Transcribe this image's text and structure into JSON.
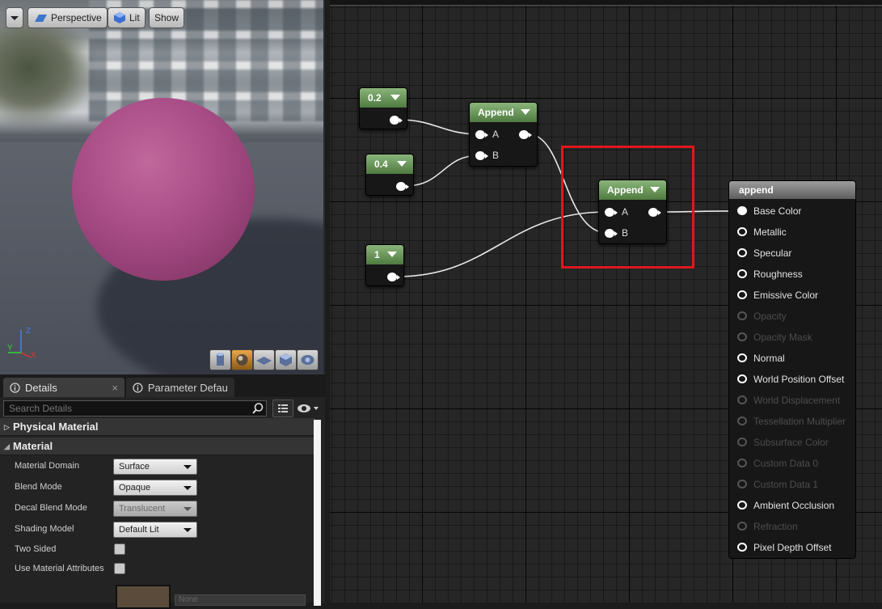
{
  "viewport": {
    "menu_label": "",
    "perspective_label": "Perspective",
    "lit_label": "Lit",
    "show_label": "Show",
    "axes": {
      "x": "X",
      "y": "Y",
      "z": "Z"
    },
    "preview_shapes": [
      "cylinder-icon",
      "sphere-icon",
      "plane-icon",
      "cube-icon",
      "custom-mesh-icon"
    ]
  },
  "details": {
    "tabs": [
      {
        "label": "Details",
        "close": "×"
      },
      {
        "label": "Parameter Defaults"
      }
    ],
    "search_placeholder": "Search Details",
    "categories": {
      "physical": "Physical Material",
      "material": "Material"
    },
    "properties": [
      {
        "label": "Material Domain",
        "value": "Surface"
      },
      {
        "label": "Blend Mode",
        "value": "Opaque"
      },
      {
        "label": "Decal Blend Mode",
        "value": "Translucent"
      },
      {
        "label": "Shading Model",
        "value": "Default Lit"
      },
      {
        "label": "Two Sided"
      },
      {
        "label": "Use Material Attributes"
      }
    ],
    "partial_value": "None"
  },
  "graph": {
    "nodes": {
      "const_02": "0.2",
      "const_04": "0.4",
      "const_1": "1",
      "append1": {
        "title": "Append",
        "a": "A",
        "b": "B"
      },
      "append2": {
        "title": "Append",
        "a": "A",
        "b": "B"
      }
    },
    "material_node": {
      "title": "append",
      "inputs": [
        {
          "label": "Base Color",
          "state": "connected"
        },
        {
          "label": "Metallic",
          "state": "active"
        },
        {
          "label": "Specular",
          "state": "active"
        },
        {
          "label": "Roughness",
          "state": "active"
        },
        {
          "label": "Emissive Color",
          "state": "active"
        },
        {
          "label": "Opacity",
          "state": "disabled"
        },
        {
          "label": "Opacity Mask",
          "state": "disabled"
        },
        {
          "label": "Normal",
          "state": "active"
        },
        {
          "label": "World Position Offset",
          "state": "active"
        },
        {
          "label": "World Displacement",
          "state": "disabled"
        },
        {
          "label": "Tessellation Multiplier",
          "state": "disabled"
        },
        {
          "label": "Subsurface Color",
          "state": "disabled"
        },
        {
          "label": "Custom Data 0",
          "state": "disabled"
        },
        {
          "label": "Custom Data 1",
          "state": "disabled"
        },
        {
          "label": "Ambient Occlusion",
          "state": "active"
        },
        {
          "label": "Refraction",
          "state": "disabled"
        },
        {
          "label": "Pixel Depth Offset",
          "state": "active"
        }
      ]
    },
    "highlight_color": "#e0161d"
  }
}
